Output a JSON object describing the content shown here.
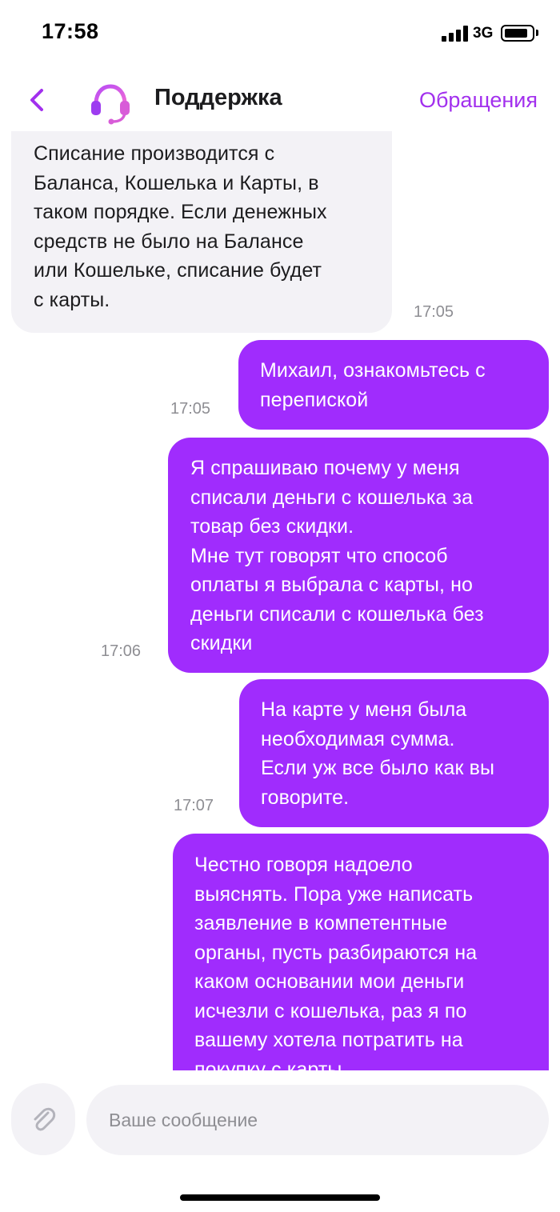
{
  "status_bar": {
    "time": "17:58",
    "network": "3G"
  },
  "header": {
    "title": "Поддержка",
    "appeals_label": "Обращения",
    "back_icon": "chevron-left-icon",
    "avatar_icon": "headset-icon",
    "accent_color": "#a230ee"
  },
  "messages": [
    {
      "direction": "incoming",
      "text": "Списание производится с\nБаланса, Кошелька и Карты, в\nтаком порядке. Если денежных\nсредств не было на Балансе\nили Кошельке, списание будет\nс карты.",
      "time": "17:05"
    },
    {
      "direction": "outgoing",
      "text": "Михаил, ознакомьтесь с\nперепиской",
      "time": "17:05"
    },
    {
      "direction": "outgoing",
      "text": "Я спрашиваю почему у меня\nсписали деньги с кошелька за\nтовар без скидки.\nМне тут говорят что способ\nоплаты я выбрала с карты, но\nденьги списали с кошелька без\nскидки",
      "time": "17:06"
    },
    {
      "direction": "outgoing",
      "text": "На карте у меня была\nнеобходимая сумма.\nЕсли уж все было как вы\nговорите.",
      "time": "17:07"
    },
    {
      "direction": "outgoing",
      "text": "Честно говоря надоело\nвыяснять. Пора уже написать\nзаявление в компетентные\nорганы, пусть разбираются на\nкаком основании мои деньги\nисчезли с кошелька, раз я по\nвашему хотела потратить на\nпокупку с карты",
      "time": ""
    }
  ],
  "colors": {
    "outgoing_bubble": "#a02cfd",
    "incoming_bubble": "#f3f2f6"
  },
  "scroll_down_icon": "chevron-down-icon",
  "composer": {
    "attach_icon": "paperclip-icon",
    "placeholder": "Ваше сообщение"
  }
}
